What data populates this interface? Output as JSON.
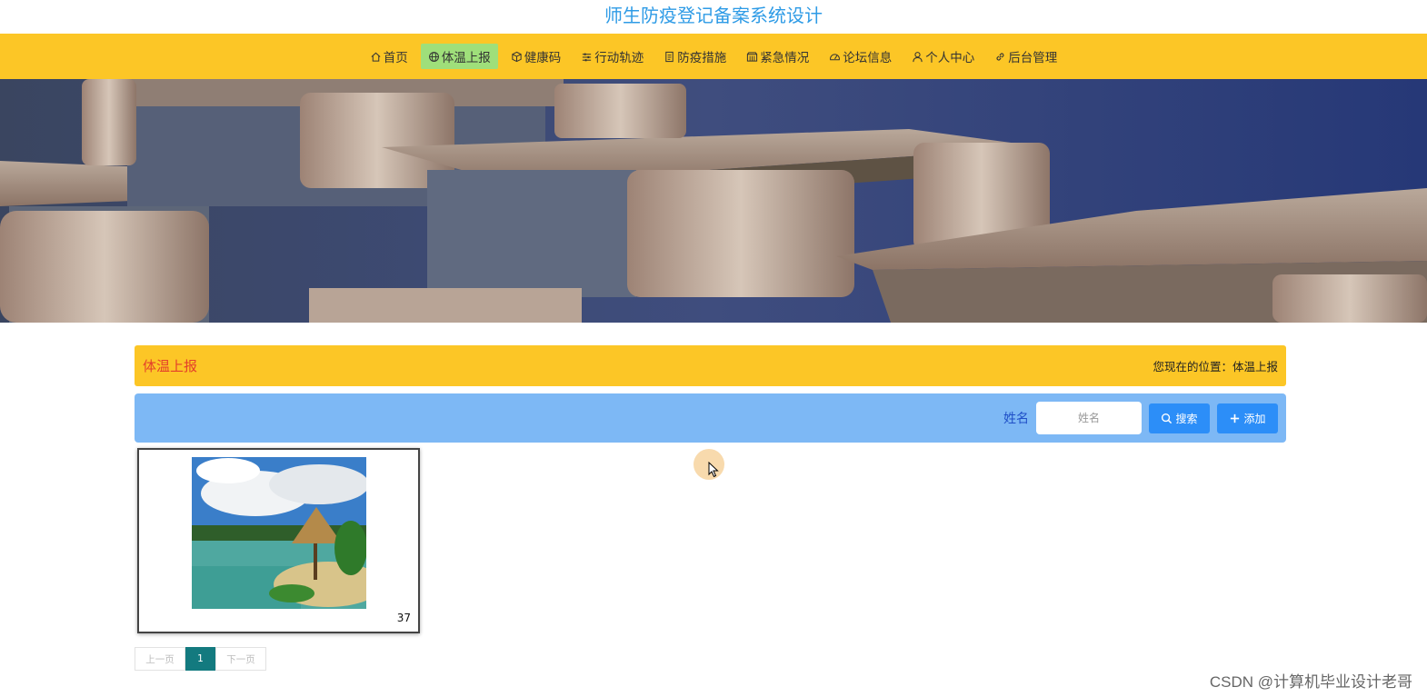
{
  "site": {
    "title": "师生防疫登记备案系统设计"
  },
  "nav": {
    "items": [
      {
        "label": "首页",
        "icon": "home-icon",
        "active": false
      },
      {
        "label": "体温上报",
        "icon": "globe-icon",
        "active": true
      },
      {
        "label": "健康码",
        "icon": "cube-icon",
        "active": false
      },
      {
        "label": "行动轨迹",
        "icon": "sliders-icon",
        "active": false
      },
      {
        "label": "防疫措施",
        "icon": "document-icon",
        "active": false
      },
      {
        "label": "紧急情况",
        "icon": "building-icon",
        "active": false
      },
      {
        "label": "论坛信息",
        "icon": "gauge-icon",
        "active": false
      },
      {
        "label": "个人中心",
        "icon": "user-icon",
        "active": false
      },
      {
        "label": "后台管理",
        "icon": "link-icon",
        "active": false
      }
    ]
  },
  "banner": {
    "slide_count": 3,
    "active_slide": 1
  },
  "breadcrumb": {
    "title": "体温上报",
    "location": "您现在的位置：体温上报"
  },
  "search": {
    "label": "姓名",
    "placeholder": "姓名",
    "value": "",
    "search_button": "搜索",
    "add_button": "添加"
  },
  "list": {
    "items": [
      {
        "value": "37",
        "image": "beach-hut-photo"
      }
    ]
  },
  "pagination": {
    "prev": "上一页",
    "current": "1",
    "next": "下一页"
  },
  "watermark": "CSDN @计算机毕业设计老哥",
  "colors": {
    "title": "#2e9be6",
    "nav_bg": "#fcc626",
    "nav_active": "#9fdf7a",
    "breadcrumb_title": "#e4402a",
    "search_bar": "#7db8f5",
    "button": "#2c8ef8",
    "page_active": "#137a7f"
  }
}
